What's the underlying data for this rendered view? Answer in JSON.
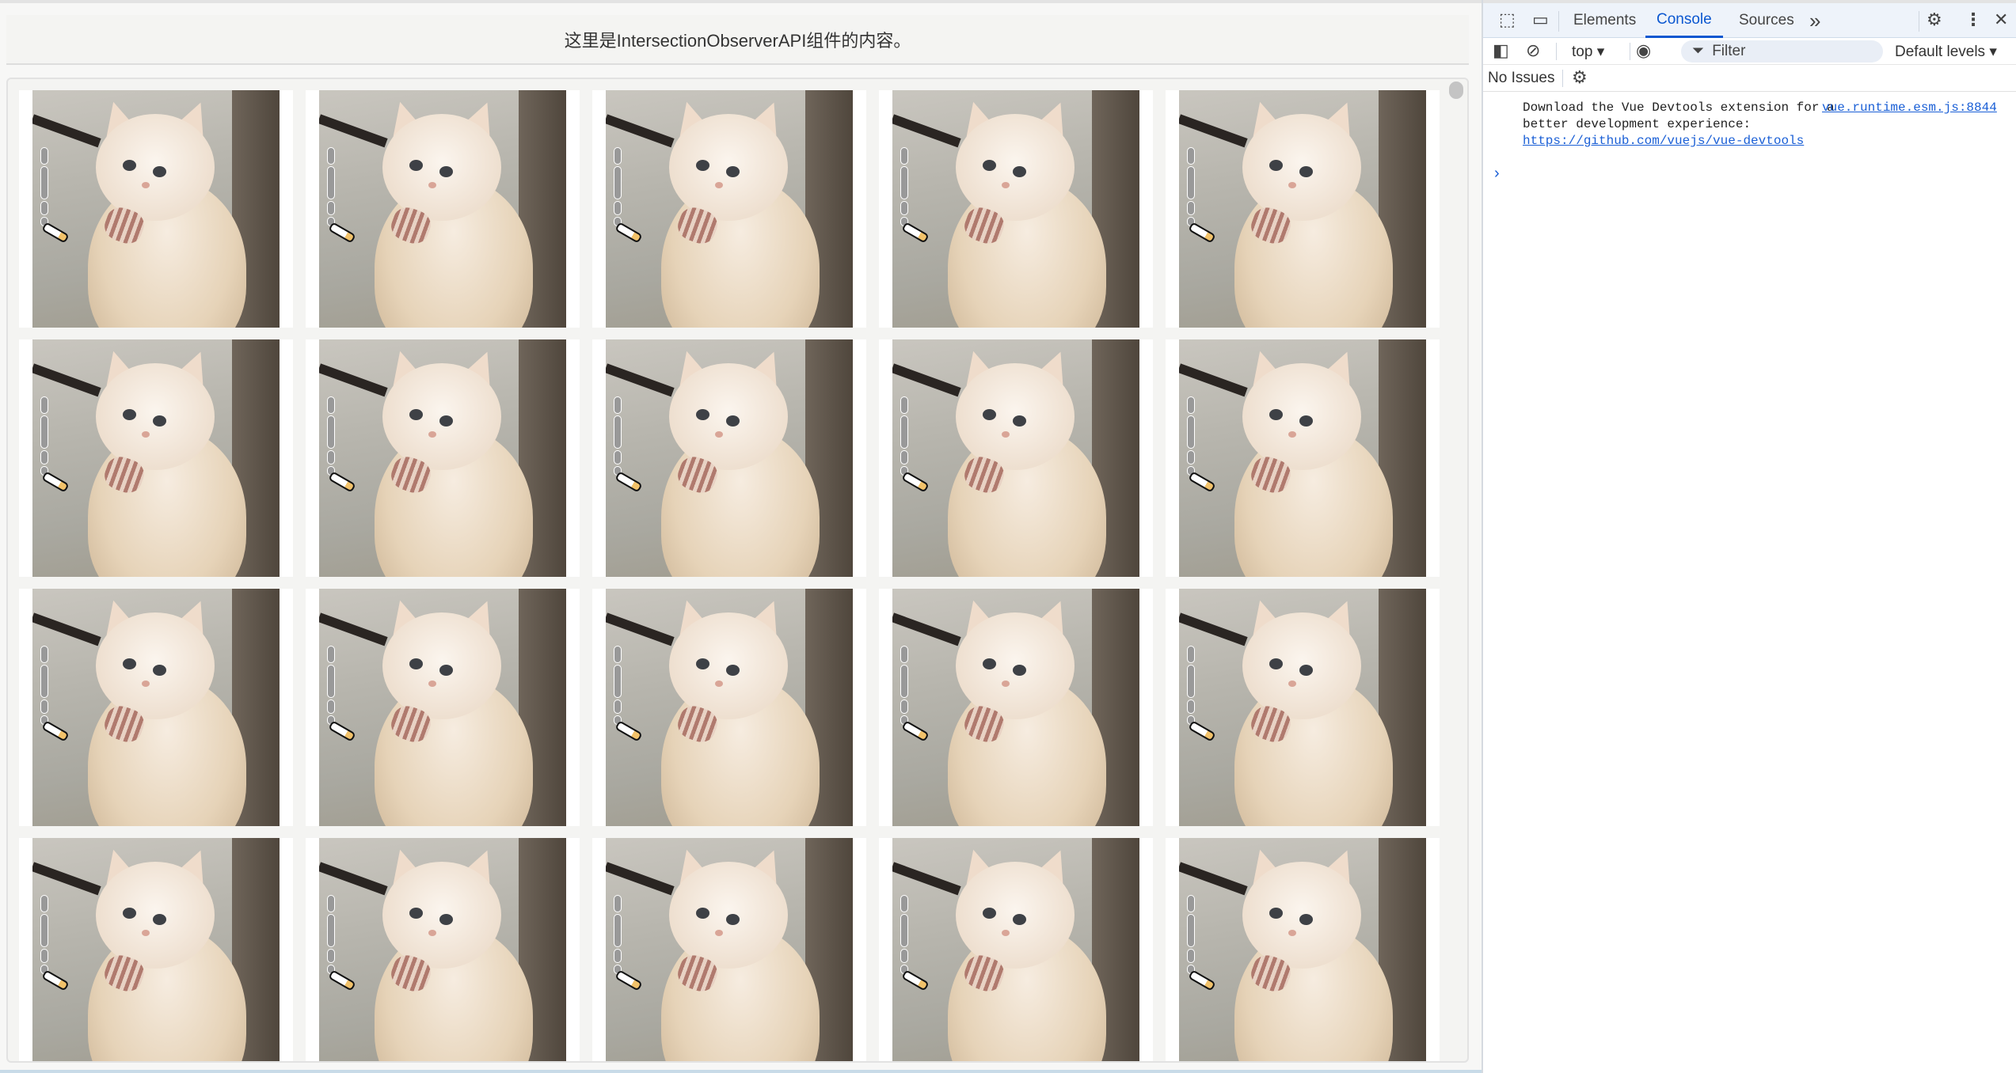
{
  "page": {
    "header_text": "这里是IntersectionObserverAPI组件的内容。",
    "grid": {
      "columns": 5,
      "card_count": 20
    }
  },
  "devtools": {
    "tabs": [
      "Elements",
      "Console",
      "Sources"
    ],
    "active_tab": "Console",
    "more_tabs": "»",
    "context": "top ▾",
    "filter_placeholder": "Filter",
    "levels": "Default levels ▾",
    "issues": "No Issues",
    "console": {
      "message_line1": "Download the Vue Devtools extension for a",
      "message_line2": "better development experience:",
      "message_link": "https://github.com/vuejs/vue-devtools",
      "source": "vue.runtime.esm.js:8844",
      "prompt": "›"
    },
    "colors": {
      "accent": "#0b57d0",
      "link": "#1a5fd6"
    }
  }
}
